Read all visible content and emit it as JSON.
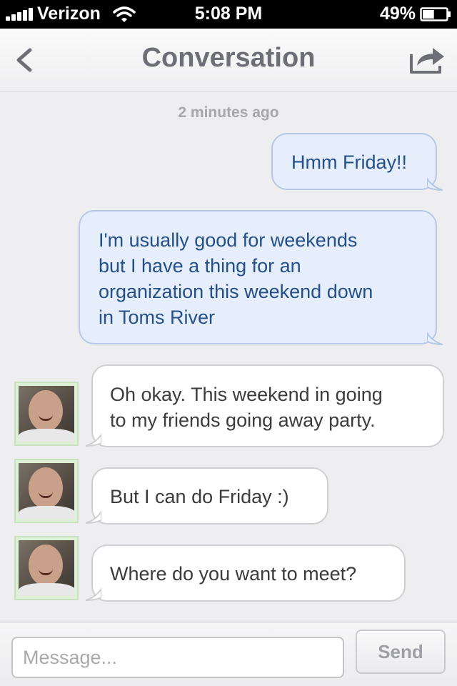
{
  "status_bar": {
    "carrier": "Verizon",
    "time": "5:08 PM",
    "battery": "49%",
    "battery_level": 0.49
  },
  "nav": {
    "back_icon": "chevron-left-icon",
    "title": "Conversation",
    "share_icon": "share-arrow-icon"
  },
  "thread": {
    "timestamp": "2 minutes ago",
    "messages": [
      {
        "direction": "outgoing",
        "lines": [
          "Hmm Friday!!"
        ]
      },
      {
        "direction": "outgoing",
        "lines": [
          "I'm usually good for weekends",
          "but I have a thing for an",
          "organization this weekend down",
          "in Toms River"
        ]
      },
      {
        "direction": "incoming",
        "lines": [
          "Oh okay. This weekend in going",
          "to my friends going away party."
        ]
      },
      {
        "direction": "incoming",
        "lines": [
          "But I can do Friday :)"
        ]
      },
      {
        "direction": "incoming",
        "lines": [
          "Where do you want to meet?"
        ]
      }
    ]
  },
  "composer": {
    "placeholder": "Message...",
    "send_label": "Send"
  },
  "colors": {
    "outgoing_bubble": "#e6eefb",
    "outgoing_text": "#24508a",
    "incoming_bubble": "#ffffff",
    "title_gray": "#6d6e76"
  }
}
